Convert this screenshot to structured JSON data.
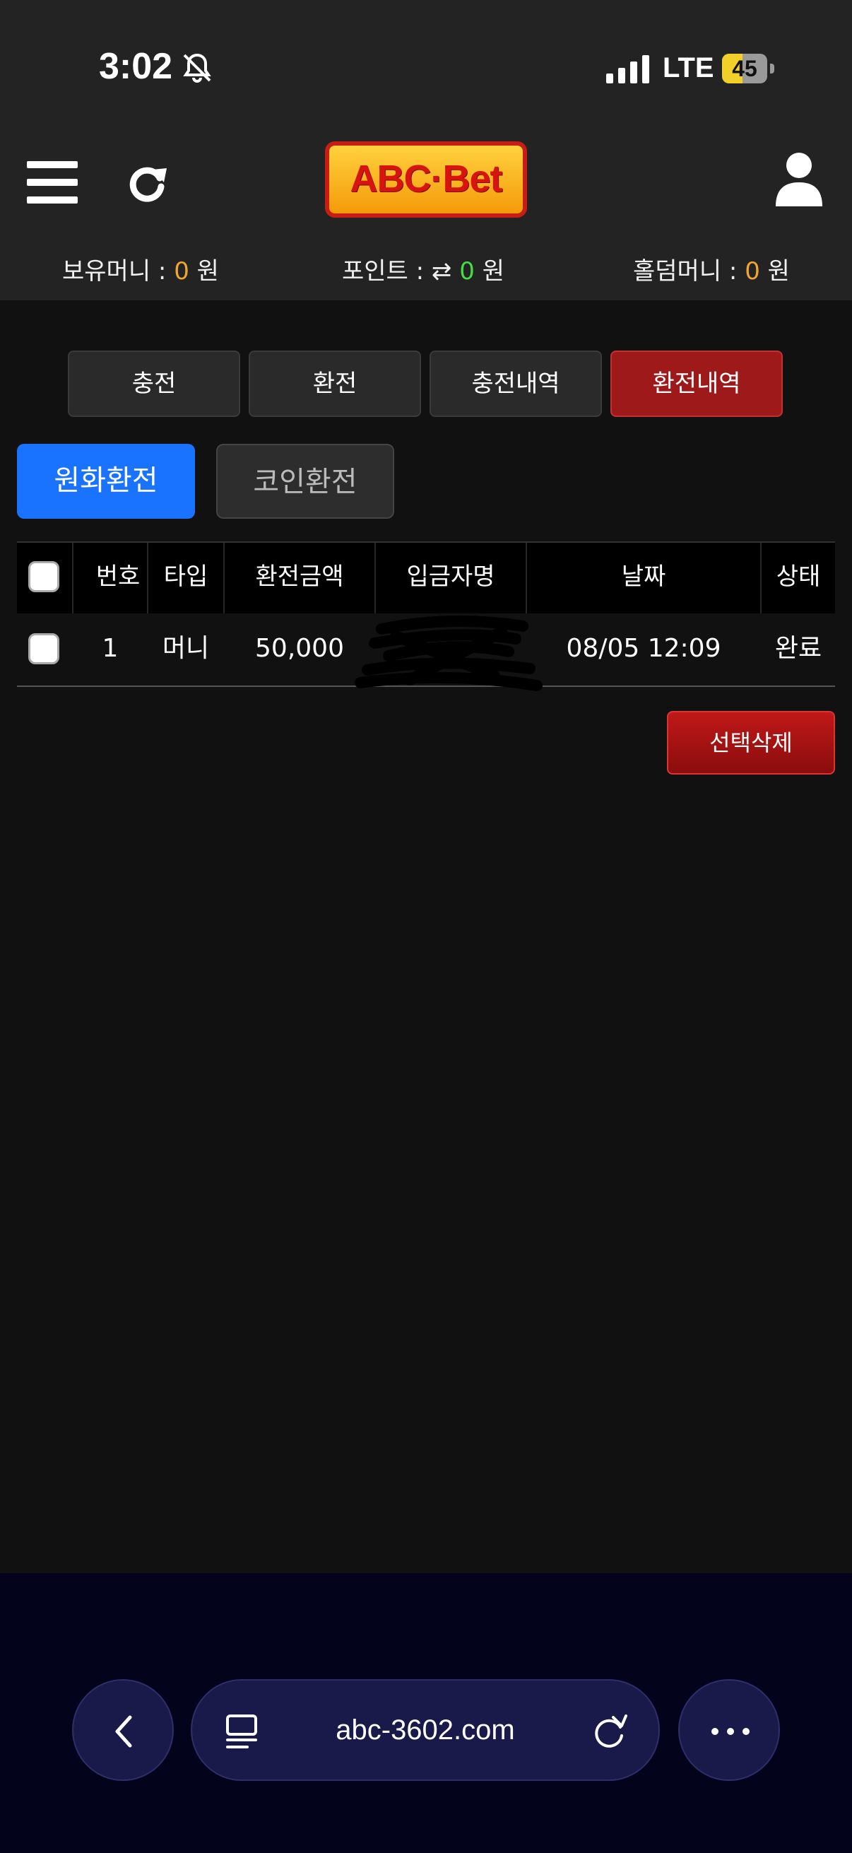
{
  "status_bar": {
    "time": "3:02",
    "network": "LTE",
    "battery_level": 45,
    "battery_text": "45"
  },
  "header": {
    "logo_text": "ABC·Bet",
    "balances": {
      "money_label": "보유머니 :",
      "money_value": "0",
      "money_unit": "원",
      "point_label": "포인트 :",
      "point_value": "0",
      "point_unit": "원",
      "holdem_label": "홀덤머니 :",
      "holdem_value": "0",
      "holdem_unit": "원"
    }
  },
  "tabs": [
    {
      "label": "충전",
      "active": false
    },
    {
      "label": "환전",
      "active": false
    },
    {
      "label": "충전내역",
      "active": false
    },
    {
      "label": "환전내역",
      "active": true
    }
  ],
  "sub_tabs": {
    "primary": "원화환전",
    "secondary": "코인환전"
  },
  "table": {
    "columns": [
      "번호",
      "타입",
      "환전금액",
      "입금자명",
      "날짜",
      "상태"
    ],
    "rows": [
      {
        "number": "1",
        "type": "머니",
        "amount": "50,000",
        "depositor": "",
        "date": "08/05 12:09",
        "status": "완료"
      }
    ]
  },
  "actions": {
    "delete_selected": "선택삭제"
  },
  "browser": {
    "url": "abc-3602.com"
  },
  "colors": {
    "accent_blue": "#1a73ff",
    "active_red": "#9e1a1a",
    "value_orange": "#f0a530",
    "value_green": "#44dd44"
  }
}
